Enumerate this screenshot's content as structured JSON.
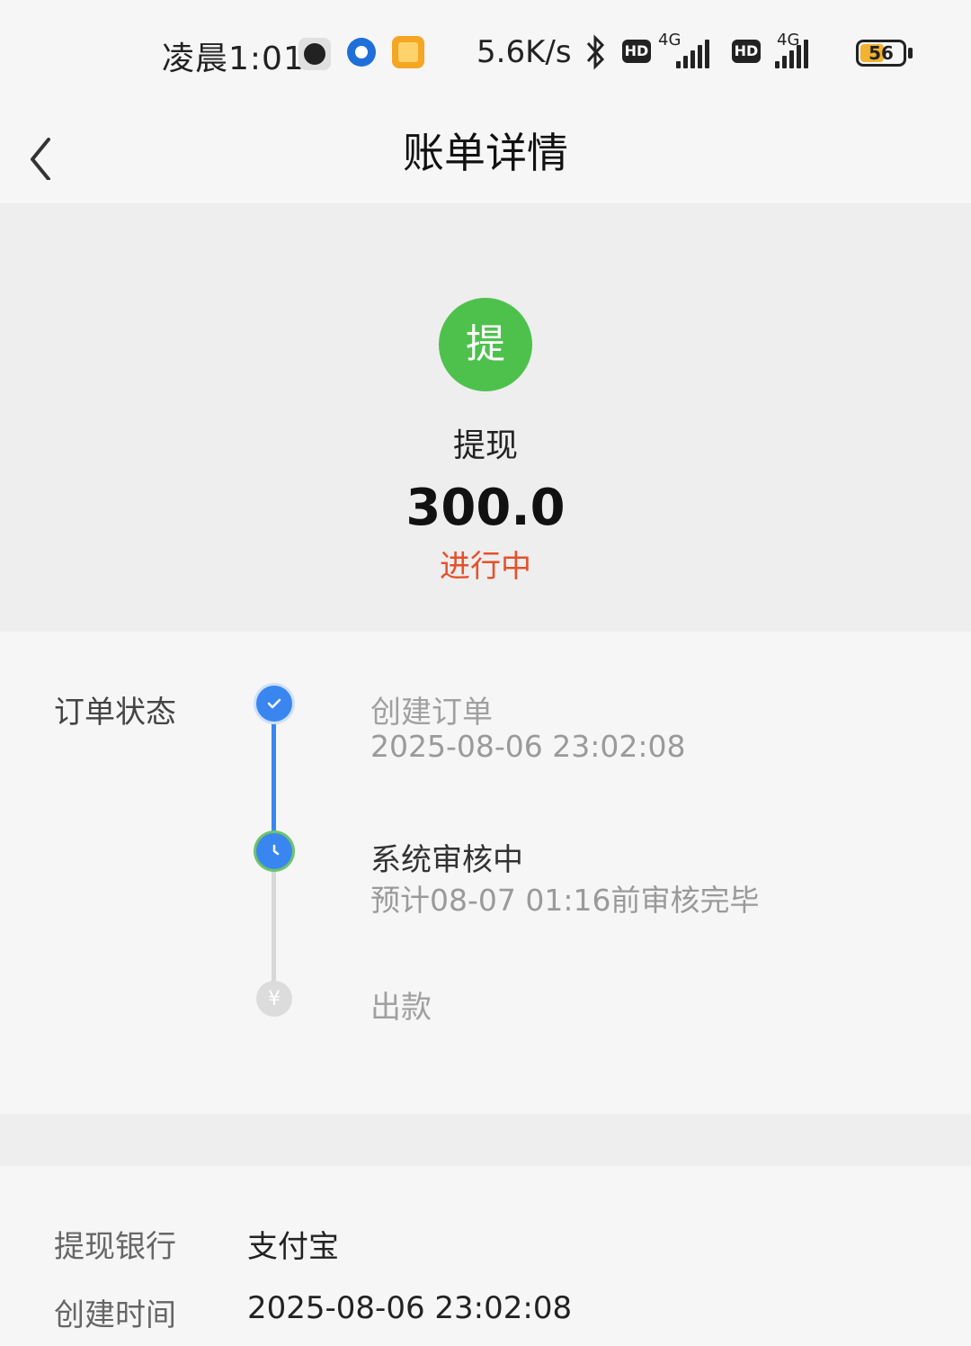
{
  "status_bar": {
    "time": "凌晨1:01",
    "network_speed": "5.6K/s",
    "hd_badge": "HD",
    "network_type": "4G",
    "battery_level": "56",
    "battery_fraction": 0.56,
    "icons": [
      "clock-icon",
      "app-icon",
      "gallery-icon",
      "bluetooth-icon",
      "signal-icon",
      "battery-icon"
    ]
  },
  "header": {
    "title": "账单详情",
    "back_icon": "chevron-left-icon"
  },
  "summary": {
    "type_badge": "提",
    "type_label": "提现",
    "amount": "300.0",
    "status": "进行中",
    "colors": {
      "badge": "#4ec14d",
      "status": "#e5512a"
    }
  },
  "order": {
    "section_label": "订单状态",
    "steps": [
      {
        "title": "创建订单",
        "subtitle": "2025-08-06 23:02:08",
        "icon": "check-icon",
        "state": "done"
      },
      {
        "title": "系统审核中",
        "subtitle": "预计08-07 01:16前审核完毕",
        "icon": "clock-icon",
        "state": "current"
      },
      {
        "title": "出款",
        "icon": "yuan-icon",
        "symbol": "¥",
        "state": "pending"
      }
    ],
    "colors": {
      "active": "#3a86f0",
      "pending": "#d8d8d8"
    }
  },
  "details": {
    "rows": [
      {
        "label": "提现银行",
        "value": "支付宝"
      },
      {
        "label": "创建时间",
        "value": "2025-08-06 23:02:08"
      }
    ]
  }
}
